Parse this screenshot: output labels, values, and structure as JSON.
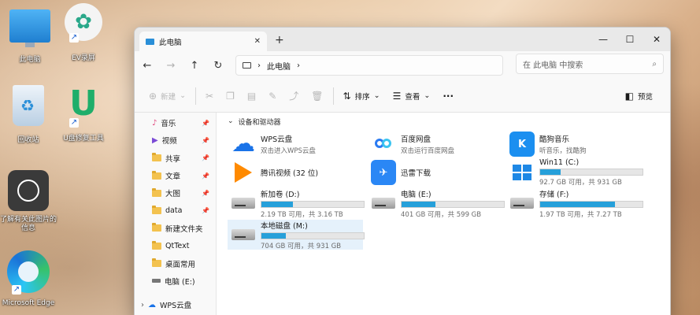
{
  "desktop": {
    "icons": [
      {
        "label": "此电脑"
      },
      {
        "label": "EV录屏"
      },
      {
        "label": "回收站"
      },
      {
        "label": "U盘修复工具"
      },
      {
        "label": "了解有关此图片的信息"
      },
      {
        "label": "Microsoft Edge"
      }
    ]
  },
  "window": {
    "tab_title": "此电脑",
    "address": {
      "crumb": "此电脑"
    },
    "search_placeholder": "在 此电脑 中搜索",
    "toolbar": {
      "new_label": "新建",
      "sort_label": "排序",
      "view_label": "查看",
      "more_label": "···",
      "preview_label": "预览"
    },
    "sidebar": {
      "items": [
        {
          "label": "音乐",
          "pinned": true
        },
        {
          "label": "视频",
          "pinned": true
        },
        {
          "label": "共享",
          "pinned": true
        },
        {
          "label": "文章",
          "pinned": true
        },
        {
          "label": "大图",
          "pinned": true
        },
        {
          "label": "data",
          "pinned": true
        },
        {
          "label": "新建文件夹",
          "pinned": false
        },
        {
          "label": "QtText",
          "pinned": false
        },
        {
          "label": "桌面常用",
          "pinned": false
        },
        {
          "label": "电脑 (E:)",
          "pinned": false
        }
      ],
      "cloud": {
        "label": "WPS云盘"
      }
    },
    "group_header": "设备和驱动器",
    "devices": [
      {
        "name": "WPS云盘",
        "sub": "双击进入WPS云盘",
        "color": "#1a73e8"
      },
      {
        "name": "百度网盘",
        "sub": "双击运行百度网盘",
        "color": "#2b7bf2"
      },
      {
        "name": "酷狗音乐",
        "sub": "听音乐，找酷狗",
        "color": "#1b8ff0"
      },
      {
        "name": "腾讯视频 (32 位)",
        "sub": "",
        "color": "#ff6a00"
      },
      {
        "name": "迅雷下载",
        "sub": "",
        "color": "#2a87f5"
      }
    ],
    "drives": [
      {
        "name": "Win11 (C:)",
        "usage": "92.7 GB 可用，共 931 GB",
        "fill": 0.2
      },
      {
        "name": "新加卷 (D:)",
        "usage": "2.19 TB 可用，共 3.16 TB",
        "fill": 0.31
      },
      {
        "name": "电脑 (E:)",
        "usage": "401 GB 可用，共 599 GB",
        "fill": 0.33
      },
      {
        "name": "存储 (F:)",
        "usage": "1.97 TB 可用，共 7.27 TB",
        "fill": 0.73
      },
      {
        "name": "本地磁盘 (M:)",
        "usage": "704 GB 可用，共 931 GB",
        "fill": 0.24
      }
    ]
  }
}
